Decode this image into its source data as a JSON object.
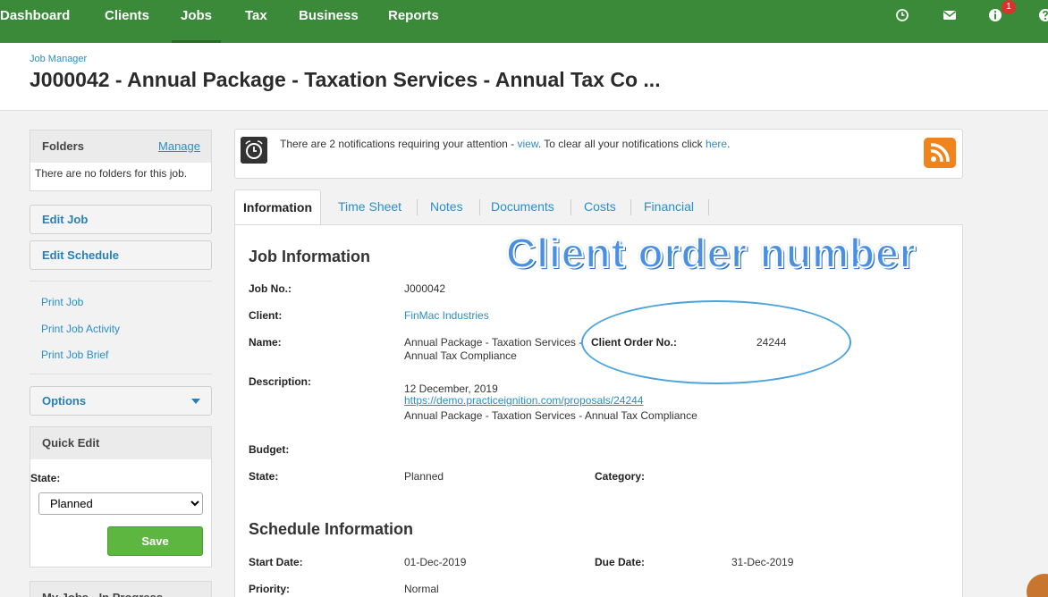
{
  "nav": {
    "items": [
      "Dashboard",
      "Clients",
      "Jobs",
      "Tax",
      "Business",
      "Reports"
    ],
    "active": "Jobs",
    "notification_count": "1",
    "icons": [
      "clock-icon",
      "mail-icon",
      "info-icon",
      "help-icon"
    ]
  },
  "header": {
    "breadcrumb": "Job Manager",
    "title": "J000042 - Annual Package - Taxation Services - Annual Tax Co ..."
  },
  "sidebar": {
    "folders_title": "Folders",
    "folders_manage": "Manage",
    "folders_empty": "There are no folders for this job.",
    "edit_job": "Edit Job",
    "edit_schedule": "Edit Schedule",
    "print_links": [
      "Print Job",
      "Print Job Activity",
      "Print Job Brief"
    ],
    "options": "Options",
    "quick_edit_title": "Quick Edit",
    "state_label": "State:",
    "state_value": "Planned",
    "save": "Save",
    "my_jobs_title": "My Jobs - In Progress"
  },
  "notification": {
    "prefix": "There are 2 notifications requiring your attention - ",
    "view_link": "view",
    "middle": ". To clear all your notifications click ",
    "here_link": "here",
    "suffix": "."
  },
  "tabs": [
    "Information",
    "Time Sheet",
    "Notes",
    "Documents",
    "Costs",
    "Financial"
  ],
  "job_info": {
    "heading": "Job Information",
    "job_no_label": "Job No.:",
    "job_no": "J000042",
    "client_label": "Client:",
    "client": "FinMac Industries",
    "name_label": "Name:",
    "name_line1": "Annual Package - Taxation Services -",
    "name_line2": "Annual Tax Compliance",
    "client_order_label": "Client Order No.:",
    "client_order": "24244",
    "description_label": "Description:",
    "description_date": "12 December, 2019",
    "description_link": "https://demo.practiceignition.com/proposals/24244",
    "description_text": "Annual Package - Taxation Services - Annual Tax Compliance",
    "budget_label": "Budget:",
    "state_label": "State:",
    "state": "Planned",
    "category_label": "Category:"
  },
  "schedule": {
    "heading": "Schedule Information",
    "start_label": "Start Date:",
    "start": "01-Dec-2019",
    "due_label": "Due Date:",
    "due": "31-Dec-2019",
    "priority_label": "Priority:",
    "priority": "Normal"
  },
  "annotation": {
    "caption": "Client order number",
    "color": "#4a90e2"
  }
}
